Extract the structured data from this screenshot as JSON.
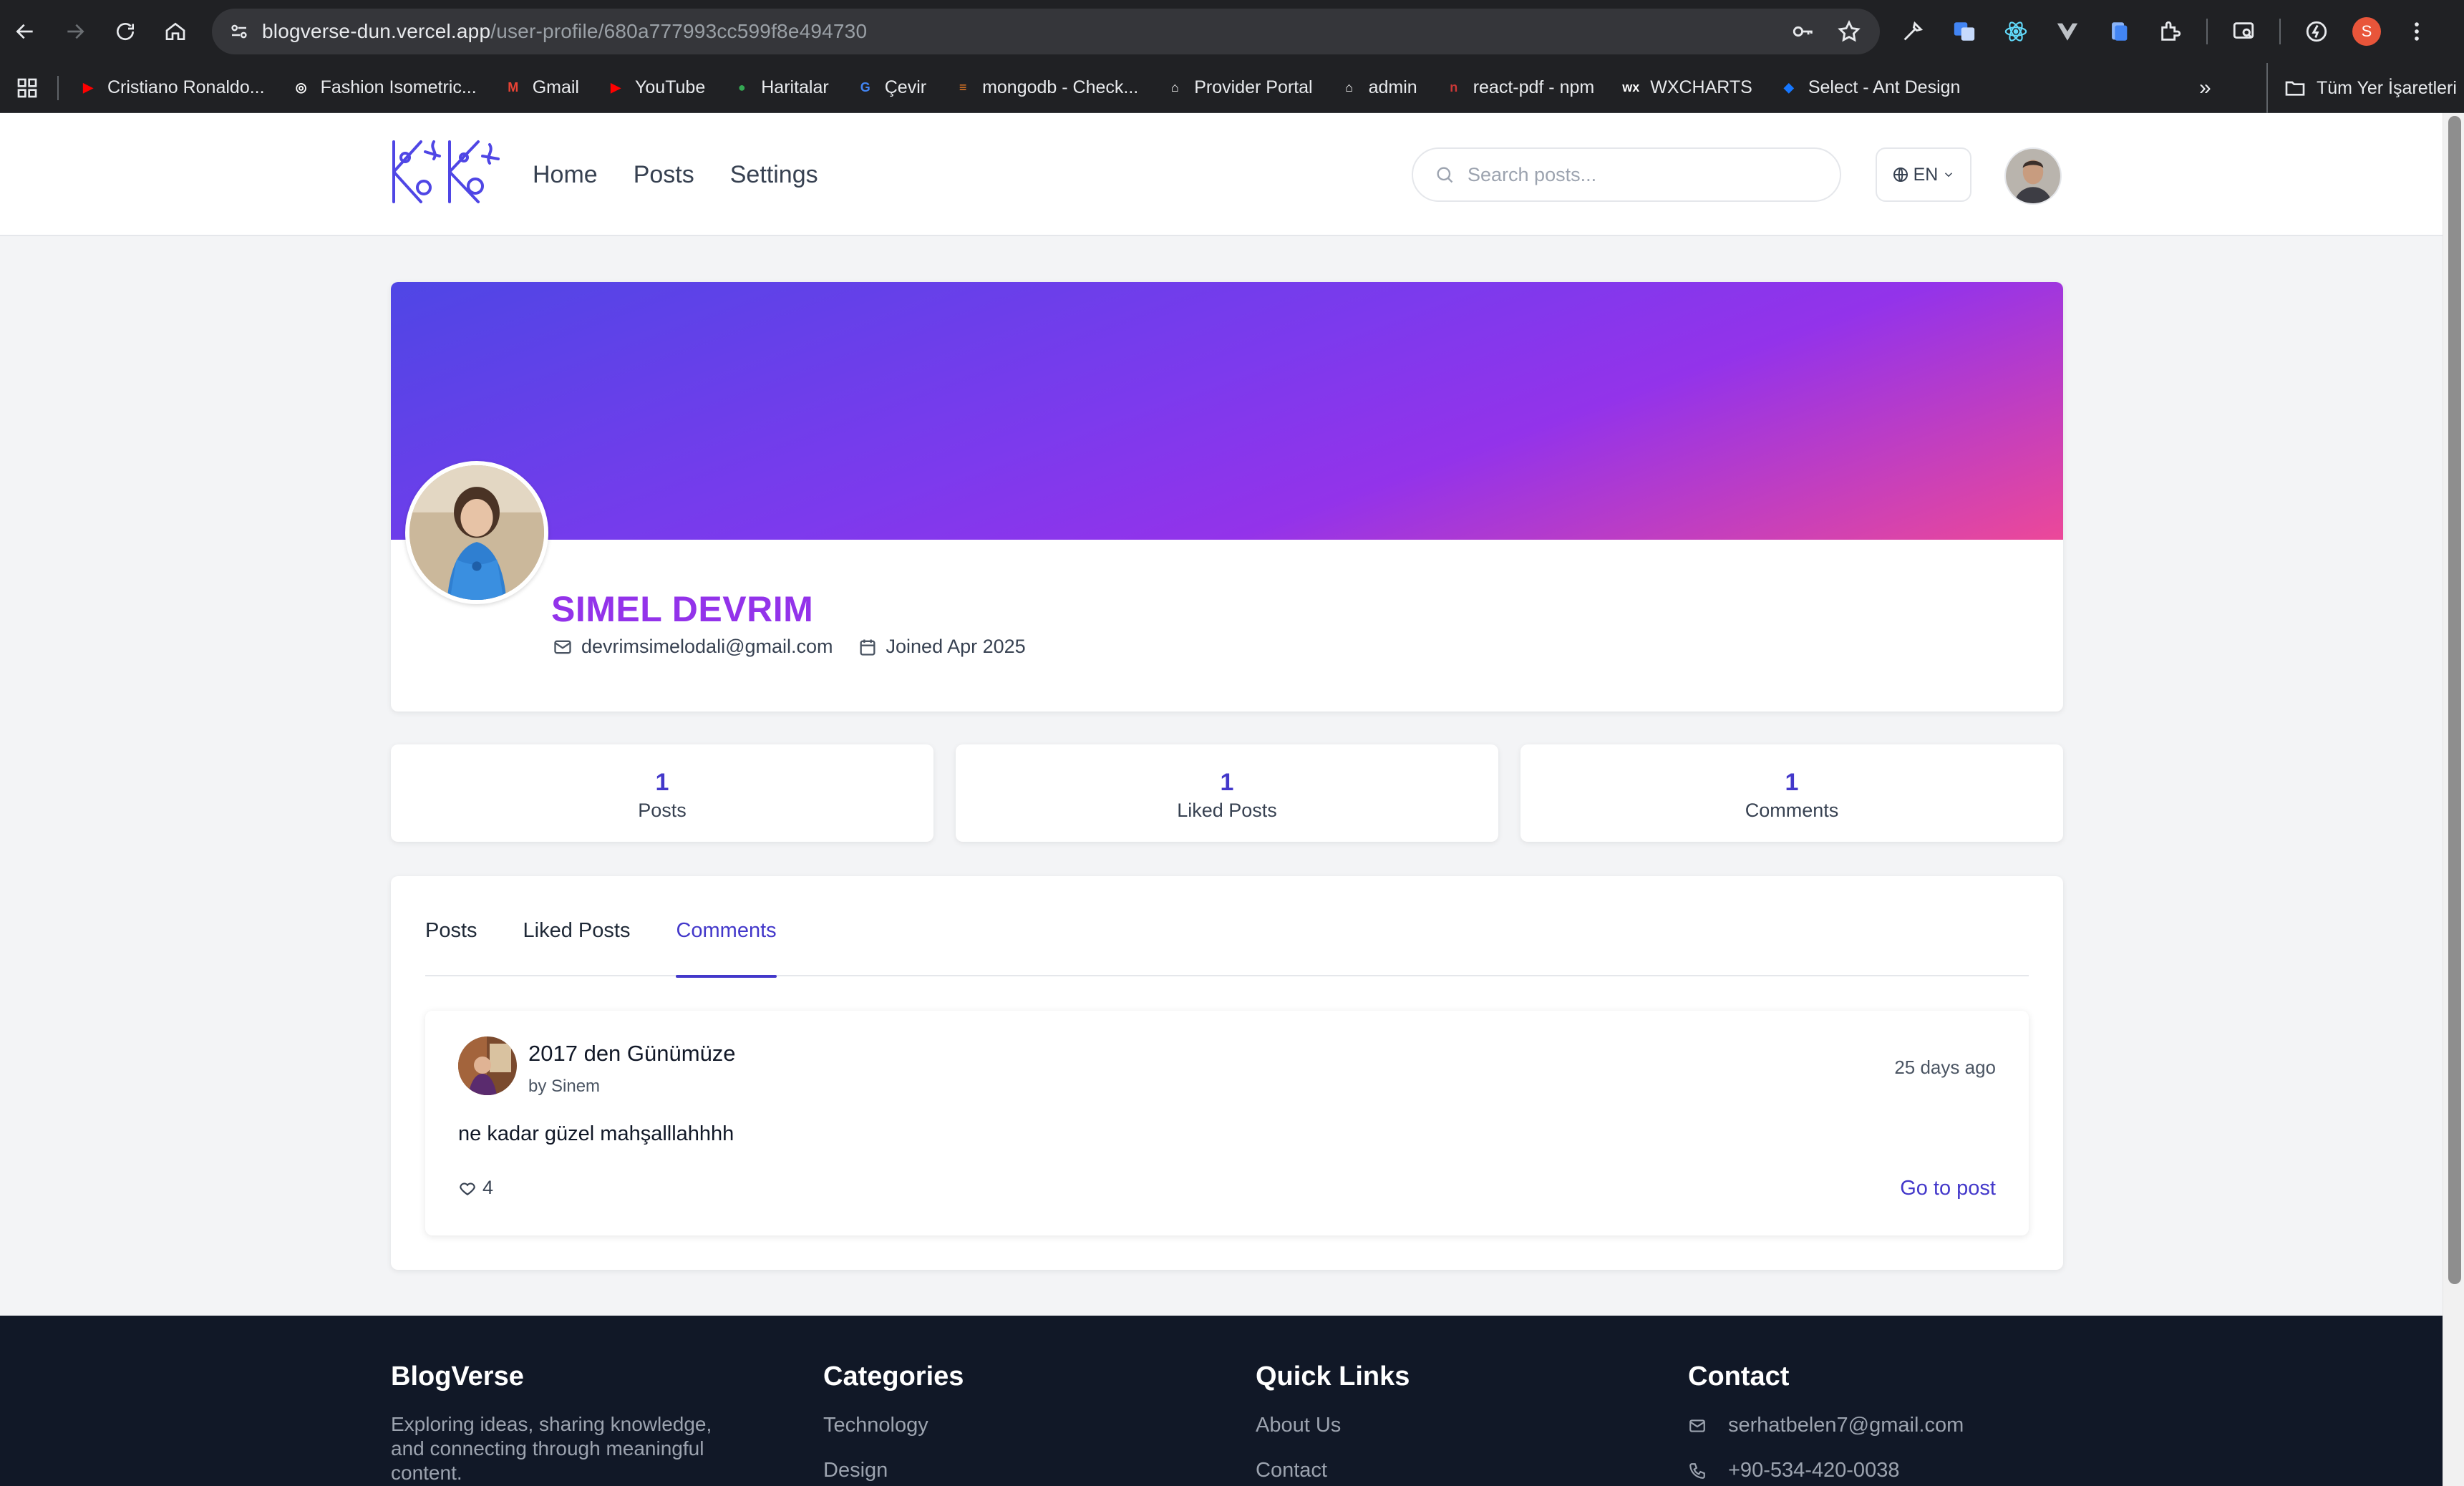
{
  "browser": {
    "url_host": "blogverse-dun.vercel.app",
    "url_path": "/user-profile/680a777993cc599f8e494730",
    "profile_initial": "S",
    "bookmarks": [
      {
        "label": "Cristiano Ronaldo...",
        "icon": "youtube-icon",
        "color": "#ff0000"
      },
      {
        "label": "Fashion Isometric...",
        "icon": "dribbble-icon",
        "color": "#ffffff"
      },
      {
        "label": "Gmail",
        "icon": "gmail-icon",
        "color": "#ea4335"
      },
      {
        "label": "YouTube",
        "icon": "youtube-icon",
        "color": "#ff0000"
      },
      {
        "label": "Haritalar",
        "icon": "maps-icon",
        "color": "#34a853"
      },
      {
        "label": "Çevir",
        "icon": "translate-icon",
        "color": "#4285f4"
      },
      {
        "label": "mongodb - Check...",
        "icon": "stackoverflow-icon",
        "color": "#f48024"
      },
      {
        "label": "Provider Portal",
        "icon": "home-icon",
        "color": "#ffffff"
      },
      {
        "label": "admin",
        "icon": "home-icon",
        "color": "#ffffff"
      },
      {
        "label": "react-pdf - npm",
        "icon": "npm-icon",
        "color": "#cb3837"
      },
      {
        "label": "WXCHARTS",
        "icon": "wx-icon",
        "color": "#ffffff"
      },
      {
        "label": "Select - Ant Design",
        "icon": "antd-icon",
        "color": "#1677ff"
      }
    ],
    "bookmarks_folder": "Tüm Yer İşaretleri"
  },
  "header": {
    "nav": [
      "Home",
      "Posts",
      "Settings"
    ],
    "search_placeholder": "Search posts...",
    "language": "EN"
  },
  "profile": {
    "name": "SIMEL DEVRIM",
    "email": "devrimsimelodali@gmail.com",
    "joined": "Joined Apr 2025"
  },
  "stats": [
    {
      "value": "1",
      "label": "Posts"
    },
    {
      "value": "1",
      "label": "Liked Posts"
    },
    {
      "value": "1",
      "label": "Comments"
    }
  ],
  "tabs": [
    {
      "label": "Posts",
      "active": false
    },
    {
      "label": "Liked Posts",
      "active": false
    },
    {
      "label": "Comments",
      "active": true
    }
  ],
  "comment": {
    "post_title": "2017 den Günümüze",
    "author": "by Sinem",
    "time": "25 days ago",
    "text": "ne kadar güzel mahşalllahhhh",
    "likes": "4",
    "link": "Go to post"
  },
  "footer": {
    "brand": {
      "title": "BlogVerse",
      "text": "Exploring ideas, sharing knowledge, and connecting through meaningful content."
    },
    "categories": {
      "title": "Categories",
      "items": [
        "Technology",
        "Design"
      ]
    },
    "quick_links": {
      "title": "Quick Links",
      "items": [
        "About Us",
        "Contact"
      ]
    },
    "contact": {
      "title": "Contact",
      "email": "serhatbelen7@gmail.com",
      "phone": "+90-534-420-0038"
    }
  },
  "colors": {
    "accent": "#4338ca",
    "name": "#9333ea",
    "cover_start": "#4f46e5",
    "cover_end": "#ec4899",
    "footer_bg": "#111827"
  }
}
